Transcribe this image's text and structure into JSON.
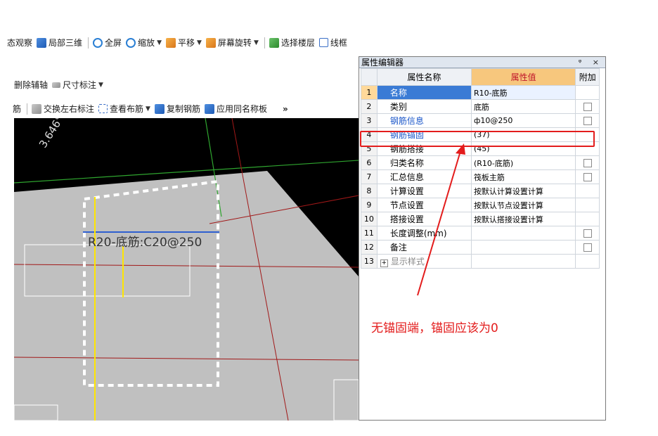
{
  "toolbar1": {
    "items": [
      "态观察",
      "局部三维",
      "全屏",
      "缩放",
      "平移",
      "屏幕旋转",
      "选择楼层",
      "线框"
    ]
  },
  "toolbar2": {
    "items": [
      "删除辅轴",
      "尺寸标注"
    ]
  },
  "toolbar3": {
    "items": [
      "筋",
      "交换左右标注",
      "查看布筋",
      "复制钢筋",
      "应用同名称板"
    ],
    "overflow": "»"
  },
  "cad": {
    "label": "R20-底筋:C20@250",
    "angle": "3.646°"
  },
  "property_editor": {
    "title": "属性编辑器",
    "controls": "ᵠ ×",
    "headers": {
      "num": "",
      "name": "属性名称",
      "value": "属性值",
      "extra": "附加"
    },
    "rows": [
      {
        "num": "1",
        "name": "名称",
        "value": "R10-底筋"
      },
      {
        "num": "2",
        "name": "类别",
        "value": "底筋"
      },
      {
        "num": "3",
        "name": "钢筋信息",
        "value": "ф10@250"
      },
      {
        "num": "4",
        "name": "钢筋锚固",
        "value": "(37)"
      },
      {
        "num": "5",
        "name": "钢筋搭接",
        "value": "(45)"
      },
      {
        "num": "6",
        "name": "归类名称",
        "value": "(R10-底筋)"
      },
      {
        "num": "7",
        "name": "汇总信息",
        "value": "筏板主筋"
      },
      {
        "num": "8",
        "name": "计算设置",
        "value": "按默认计算设置计算"
      },
      {
        "num": "9",
        "name": "节点设置",
        "value": "按默认节点设置计算"
      },
      {
        "num": "10",
        "name": "搭接设置",
        "value": "按默认搭接设置计算"
      },
      {
        "num": "11",
        "name": "长度调整(mm)",
        "value": ""
      },
      {
        "num": "12",
        "name": "备注",
        "value": ""
      },
      {
        "num": "13",
        "name": "显示样式",
        "value": ""
      }
    ],
    "expander": "+"
  },
  "annotation": {
    "text": "无锚固端，锚固应该为0",
    "color": "#e31c1c"
  }
}
